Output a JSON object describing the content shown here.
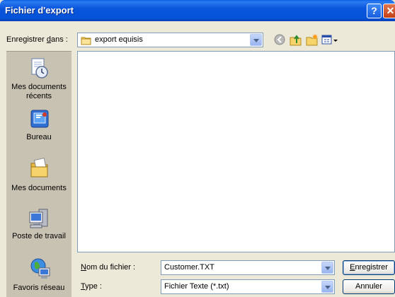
{
  "window": {
    "title": "Fichier d'export",
    "help_label": "?",
    "close_label": "✕"
  },
  "save_in": {
    "label_pre": "Enregistrer ",
    "label_accel": "d",
    "label_post": "ans :",
    "value": "export equisis"
  },
  "places": [
    {
      "label_line1": "Mes documents",
      "label_line2": "récents",
      "icon": "recent-documents-icon"
    },
    {
      "label_line1": "Bureau",
      "label_line2": "",
      "icon": "desktop-icon"
    },
    {
      "label_line1": "Mes documents",
      "label_line2": "",
      "icon": "my-documents-icon"
    },
    {
      "label_line1": "Poste de travail",
      "label_line2": "",
      "icon": "my-computer-icon"
    },
    {
      "label_line1": "Favoris réseau",
      "label_line2": "",
      "icon": "network-places-icon"
    }
  ],
  "filename": {
    "label_accel": "N",
    "label_post": "om du fichier :",
    "value": "Customer.TXT"
  },
  "filetype": {
    "label_accel": "T",
    "label_post": "ype :",
    "value": "Fichier Texte (*.txt)"
  },
  "buttons": {
    "save_accel": "E",
    "save_post": "nregistrer",
    "cancel": "Annuler"
  },
  "colors": {
    "titlebar": "#0453d8",
    "dialog_bg": "#ece9d8",
    "places_bg": "#c8c2b3"
  }
}
